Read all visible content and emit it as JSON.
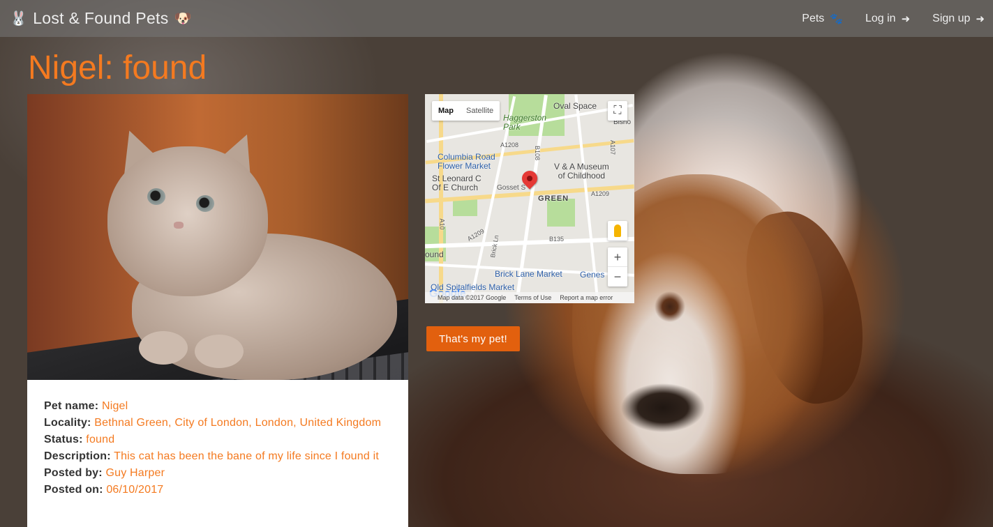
{
  "navbar": {
    "brand": "Lost & Found Pets",
    "brand_left_emoji": "🐰",
    "brand_right_emoji": "🐶",
    "links": [
      {
        "label": "Pets",
        "icon": "paw-icon",
        "glyph": "🐾"
      },
      {
        "label": "Log in",
        "icon": "login-icon",
        "glyph": "➜"
      },
      {
        "label": "Sign up",
        "icon": "signup-icon",
        "glyph": "➜"
      }
    ]
  },
  "page": {
    "title": "Nigel: found"
  },
  "details": {
    "pet_name_label": "Pet name:",
    "pet_name": "Nigel",
    "locality_label": "Locality:",
    "locality": "Bethnal Green, City of London, London, United Kingdom",
    "status_label": "Status:",
    "status": "found",
    "description_label": "Description:",
    "description": "This cat has been the bane of my life since I found it",
    "posted_by_label": "Posted by:",
    "posted_by": "Guy Harper",
    "posted_on_label": "Posted on:",
    "posted_on": "06/10/2017"
  },
  "map": {
    "type_map": "Map",
    "type_satellite": "Satellite",
    "zoom_in": "+",
    "zoom_out": "−",
    "labels": {
      "oval_space": "Oval Space",
      "bishop": "Bisho",
      "haggerston": "Haggerston\nPark",
      "a1208": "A1208",
      "b108": "B108",
      "a107": "A107",
      "columbia": "Columbia Road\nFlower Market",
      "va_museum": "V & A Museum\nof Childhood",
      "st_leonard": "St Leonard C\nOf E Church",
      "gosset": "Gosset S",
      "green": "GREEN",
      "a1209": "A1209",
      "a10": "A10",
      "a1209b": "A1209",
      "brick_ln": "Brick Ln",
      "b135": "B135",
      "ound": "ound",
      "brick_lane_market": "Brick Lane Market",
      "genes": "Genes",
      "spitalfields": "Old Spitalfields Market"
    },
    "footer_data": "Map data ©2017 Google",
    "footer_terms": "Terms of Use",
    "footer_report": "Report a map error",
    "google": "Google"
  },
  "actions": {
    "claim_label": "That's my pet!"
  },
  "colors": {
    "accent": "#f47a20",
    "button": "#e2600e"
  }
}
